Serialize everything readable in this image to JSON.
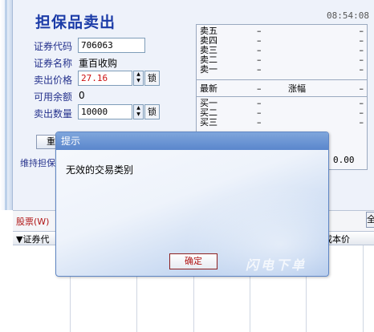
{
  "window": {
    "title": "担保品卖出",
    "clock": "08:54:08"
  },
  "form": {
    "code_label": "证券代码",
    "code_value": "706063",
    "name_label": "证券名称",
    "name_value": "重百收购",
    "price_label": "卖出价格",
    "price_value": "27.16",
    "lock_label": "锁",
    "avail_label": "可用余额",
    "avail_value": "0",
    "qty_label": "卖出数量",
    "qty_value": "10000",
    "reset_button": "重",
    "weichi_label": "维持担保"
  },
  "quote": {
    "sell_rows": [
      {
        "label": "卖五",
        "value": "–",
        "value2": "–"
      },
      {
        "label": "卖四",
        "value": "–",
        "value2": "–"
      },
      {
        "label": "卖三",
        "value": "–",
        "value2": "–"
      },
      {
        "label": "卖二",
        "value": "–",
        "value2": "–"
      },
      {
        "label": "卖一",
        "value": "–",
        "value2": "–"
      }
    ],
    "latest_label": "最新",
    "latest_value": "–",
    "change_label": "涨幅",
    "change_value": "–",
    "buy_rows": [
      {
        "label": "买一",
        "value": "–",
        "value2": "–"
      },
      {
        "label": "买二",
        "value": "–",
        "value2": "–"
      },
      {
        "label": "买三",
        "value": "–",
        "value2": "–"
      }
    ],
    "ratio_value": "0.00"
  },
  "tabs": {
    "stock_tab": "股票(W)",
    "right_button": "全"
  },
  "table": {
    "col_code": "▼证券代",
    "col_cost": "成本价"
  },
  "dialog": {
    "title": "提示",
    "message": "无效的交易类别",
    "ok_button": "确定",
    "brand": "闪电下单"
  }
}
